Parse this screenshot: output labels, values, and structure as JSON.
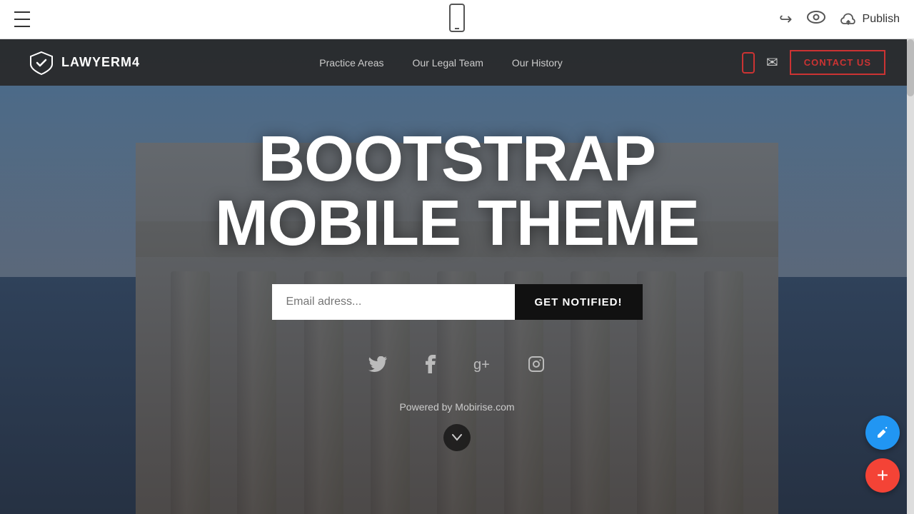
{
  "toolbar": {
    "publish_label": "Publish",
    "hamburger_label": "Menu"
  },
  "site": {
    "logo_text": "LAWYERM4",
    "nav": {
      "link1": "Practice Areas",
      "link2": "Our Legal Team",
      "link3": "Our History",
      "contact_btn": "CONTACT US"
    },
    "hero": {
      "title_line1": "BOOTSTRAP",
      "title_line2": "MOBILE THEME",
      "email_placeholder": "Email adress...",
      "notify_btn": "GET NOTIFIED!",
      "powered_by": "Powered by Mobirise.com"
    }
  }
}
